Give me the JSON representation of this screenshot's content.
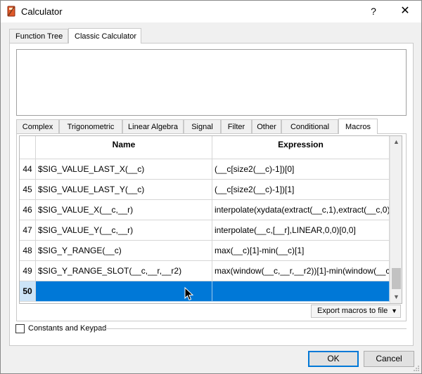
{
  "window": {
    "title": "Calculator",
    "help_glyph": "?",
    "close_glyph": "✕"
  },
  "top_tabs": [
    {
      "label": "Function Tree",
      "active": false
    },
    {
      "label": "Classic Calculator",
      "active": true
    }
  ],
  "expression_input": {
    "value": ""
  },
  "inner_tabs": [
    {
      "label": "Complex",
      "active": false
    },
    {
      "label": "Trigonometric",
      "active": false
    },
    {
      "label": "Linear Algebra",
      "active": false
    },
    {
      "label": "Signal",
      "active": false
    },
    {
      "label": "Filter",
      "active": false
    },
    {
      "label": "Other",
      "active": false
    },
    {
      "label": "Conditional",
      "active": false
    },
    {
      "label": "Macros",
      "active": true
    }
  ],
  "macros_table": {
    "columns": [
      "Name",
      "Expression"
    ],
    "rows": [
      {
        "num": "44",
        "name": "$SIG_VALUE_LAST_X(__c)",
        "expression": "(__c[size2(__c)-1])[0]"
      },
      {
        "num": "45",
        "name": "$SIG_VALUE_LAST_Y(__c)",
        "expression": "(__c[size2(__c)-1])[1]"
      },
      {
        "num": "46",
        "name": "$SIG_VALUE_X(__c,__r)",
        "expression": "interpolate(xydata(extract(__c,1),extract(__c,0)..."
      },
      {
        "num": "47",
        "name": "$SIG_VALUE_Y(__c,__r)",
        "expression": "interpolate(__c,[__r],LINEAR,0,0)[0,0]"
      },
      {
        "num": "48",
        "name": "$SIG_Y_RANGE(__c)",
        "expression": "max(__c)[1]-min(__c)[1]"
      },
      {
        "num": "49",
        "name": "$SIG_Y_RANGE_SLOT(__c,__r,__r2)",
        "expression": "max(window(__c,__r,__r2))[1]-min(window(__c,..."
      },
      {
        "num": "50",
        "name": "",
        "expression": "",
        "selected": true
      }
    ]
  },
  "scrollbar": {
    "up_glyph": "▲",
    "down_glyph": "▼"
  },
  "export_button": {
    "label": "Export macros to file",
    "arrow": "▼"
  },
  "constants_checkbox": {
    "label": "Constants and Keypad",
    "checked": false
  },
  "buttons": {
    "ok": "OK",
    "cancel": "Cancel"
  }
}
